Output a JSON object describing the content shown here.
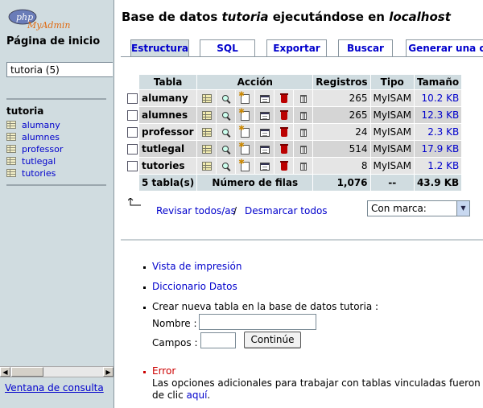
{
  "nav": {
    "logo_php": "php",
    "logo_myadmin": "MyAdmin",
    "home": "Página de inicio",
    "db_selected": "tutoria (5)",
    "db_name": "tutoria",
    "tables": [
      "alumany",
      "alumnes",
      "professor",
      "tutlegal",
      "tutories"
    ],
    "query_window": "Ventana de consulta"
  },
  "header": {
    "title_prefix": "Base de datos ",
    "db": "tutoria",
    "title_mid": " ejecutándose en ",
    "host": "localhost"
  },
  "tabs": [
    "Estructura",
    "SQL",
    "Exportar",
    "Buscar",
    "Generar una co"
  ],
  "table": {
    "headers": {
      "table": "Tabla",
      "action": "Acción",
      "records": "Registros",
      "type": "Tipo",
      "size": "Tamaño"
    },
    "rows": [
      {
        "name": "alumany",
        "records": "265",
        "type": "MyISAM",
        "size": "10.2 KB"
      },
      {
        "name": "alumnes",
        "records": "265",
        "type": "MyISAM",
        "size": "12.3 KB"
      },
      {
        "name": "professor",
        "records": "24",
        "type": "MyISAM",
        "size": "2.3 KB"
      },
      {
        "name": "tutlegal",
        "records": "514",
        "type": "MyISAM",
        "size": "17.9 KB"
      },
      {
        "name": "tutories",
        "records": "8",
        "type": "MyISAM",
        "size": "1.2 KB"
      }
    ],
    "total": {
      "count": "5 tabla(s)",
      "label": "Número de filas",
      "records": "1,076",
      "type": "--",
      "size": "43.9 KB"
    }
  },
  "selection": {
    "check_all": "Revisar todos/as",
    "separator": "/",
    "uncheck_all": "Desmarcar todos",
    "with_selected": "Con marca:"
  },
  "links": {
    "print_view": "Vista de impresión",
    "data_dictionary": "Diccionario Datos",
    "create_table": "Crear nueva tabla en la base de datos tutoria :",
    "name_label": "Nombre :",
    "fields_label": "Campos :",
    "go": "Continúe"
  },
  "error": {
    "label": "Error",
    "msg_line1": "Las opciones adicionales para trabajar con tablas vinculadas fueron desact",
    "msg_line2_prefix": "de clic ",
    "msg_link": "aquí",
    "msg_line2_suffix": "."
  }
}
